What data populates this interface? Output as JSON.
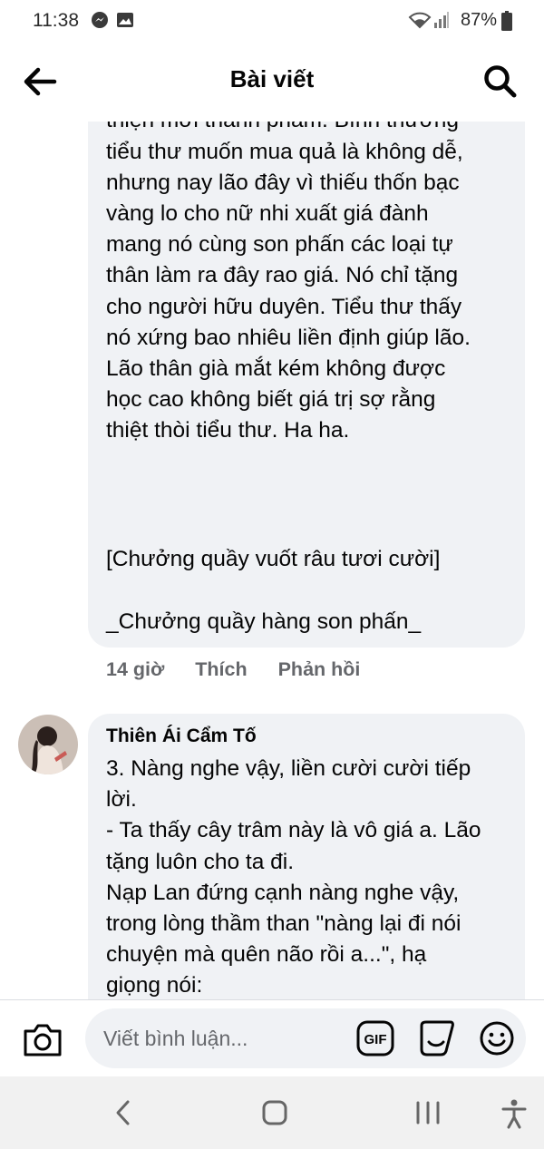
{
  "status_bar": {
    "time": "11:38",
    "battery": "87%",
    "icons": [
      "messenger-icon",
      "image-icon",
      "wifi-icon",
      "signal-icon",
      "battery-icon"
    ]
  },
  "header": {
    "title": "Bài viết",
    "back_icon": "arrow-left-icon",
    "search_icon": "search-icon"
  },
  "comments": [
    {
      "body": "khắc mời vẽ vị nổi tiếng nhất vùng\nVân Nam này tốn tam công nhật\nthiện mới thành phẩm. Bình thường\ntiểu thư muốn mua quả là không dễ,\nnhưng nay lão đây vì thiếu thốn bạc\nvàng lo cho nữ nhi xuất giá đành\nmang nó cùng son phấn các loại tự\nthân làm ra đây rao giá. Nó chỉ tặng\ncho người hữu duyên. Tiểu thư thấy\nnó xứng bao nhiêu liền định giúp lão.\nLão thân già mắt kém không được\nhọc cao không biết giá trị sợ rằng\nthiệt thòi tiểu thư. Ha ha.",
      "action_line": "[Chưởng quầy vuốt râu tươi cười]",
      "signature": "_Chưởng quầy hàng son phấn_",
      "time": "14 giờ",
      "like_label": "Thích",
      "reply_label": "Phản hồi"
    },
    {
      "author": "Thiên Ái Cẩm Tố",
      "body": "3. Nàng nghe vậy, liền cười cười tiếp\nlời.\n- Ta thấy cây trâm này là vô giá a. Lão\ntặng luôn cho ta đi.\nNạp Lan đứng cạnh nàng nghe vậy,\ntrong lòng thầm than \"nàng lại đi nói\nchuyện mà quên não rồi a...\", hạ\ngiọng nói:"
    }
  ],
  "composer": {
    "placeholder": "Viết bình luận...",
    "icons": [
      "camera-icon",
      "gif-icon",
      "sticker-icon",
      "emoji-icon"
    ]
  },
  "nav_bar": {
    "icons": [
      "back-icon",
      "home-icon",
      "recents-icon",
      "accessibility-icon"
    ]
  },
  "colors": {
    "bubble": "#f0f2f5",
    "meta_text": "#65676b",
    "text": "#050505",
    "nav_bg": "#f1f1f1"
  }
}
